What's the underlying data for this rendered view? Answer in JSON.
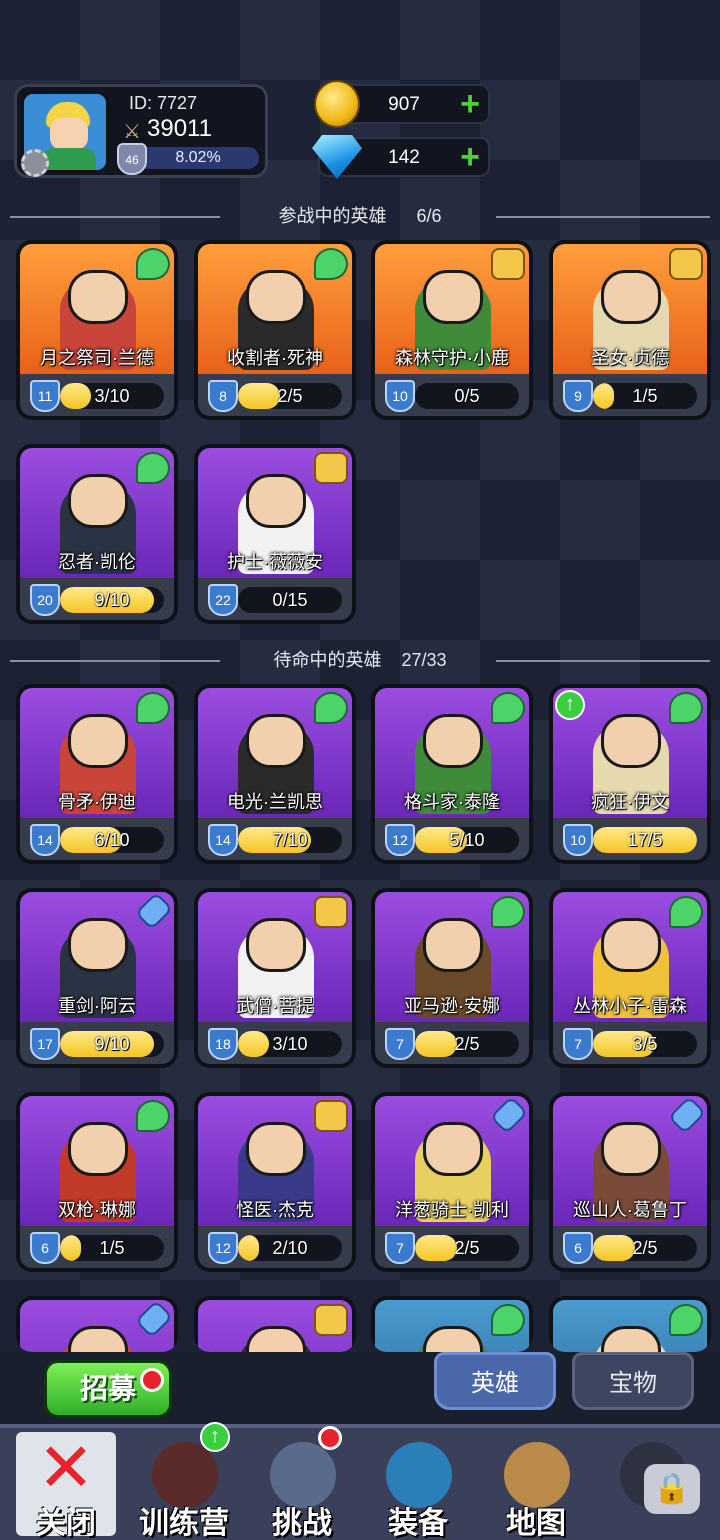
{
  "player": {
    "id_label": "ID: 7727",
    "power": "39011",
    "level": "46",
    "exp_percent": "8.02%"
  },
  "resources": {
    "gold": "907",
    "gems": "142",
    "plus": "+"
  },
  "sections": {
    "active_title": "参战中的英雄      6/6",
    "standby_title": "待命中的英雄    27/33"
  },
  "active_heroes": [
    {
      "name": "月之祭司·兰德",
      "level": "11",
      "progress": "3/10",
      "fill": 0.3,
      "color": "orange",
      "badge": "wing-icon"
    },
    {
      "name": "收割者·死神",
      "level": "8",
      "progress": "2/5",
      "fill": 0.4,
      "color": "orange",
      "badge": "wing-icon"
    },
    {
      "name": "森林守护·小鹿",
      "level": "10",
      "progress": "0/5",
      "fill": 0.0,
      "color": "orange",
      "badge": "book-icon"
    },
    {
      "name": "圣女·贞德",
      "level": "9",
      "progress": "1/5",
      "fill": 0.2,
      "color": "orange",
      "badge": "book-icon"
    },
    {
      "name": "忍者·凯伦",
      "level": "20",
      "progress": "9/10",
      "fill": 0.9,
      "color": "purple",
      "badge": "wing-icon"
    },
    {
      "name": "护士·薇薇安",
      "level": "22",
      "progress": "0/15",
      "fill": 0.0,
      "color": "purple",
      "badge": "book-icon"
    }
  ],
  "standby_heroes": [
    {
      "name": "骨矛·伊迪",
      "level": "14",
      "progress": "6/10",
      "fill": 0.6,
      "color": "purple",
      "badge": "wing-icon"
    },
    {
      "name": "电光·兰凯思",
      "level": "14",
      "progress": "7/10",
      "fill": 0.7,
      "color": "purple",
      "badge": "wing-icon"
    },
    {
      "name": "格斗家·泰隆",
      "level": "12",
      "progress": "5/10",
      "fill": 0.5,
      "color": "purple",
      "badge": "wing-icon"
    },
    {
      "name": "疯狂·伊文",
      "level": "10",
      "progress": "17/5",
      "fill": 1.0,
      "color": "purple",
      "badge": "wing-icon",
      "upgrade": true
    },
    {
      "name": "重剑·阿云",
      "level": "17",
      "progress": "9/10",
      "fill": 0.9,
      "color": "purple",
      "badge": "sword-icon"
    },
    {
      "name": "武僧·菩提",
      "level": "18",
      "progress": "3/10",
      "fill": 0.3,
      "color": "purple",
      "badge": "book-icon"
    },
    {
      "name": "亚马逊·安娜",
      "level": "7",
      "progress": "2/5",
      "fill": 0.4,
      "color": "purple",
      "badge": "wing-icon"
    },
    {
      "name": "丛林小子·雷森",
      "level": "7",
      "progress": "3/5",
      "fill": 0.6,
      "color": "purple",
      "badge": "wing-icon"
    },
    {
      "name": "双枪·琳娜",
      "level": "6",
      "progress": "1/5",
      "fill": 0.2,
      "color": "purple",
      "badge": "wing-icon"
    },
    {
      "name": "怪医·杰克",
      "level": "12",
      "progress": "2/10",
      "fill": 0.2,
      "color": "purple",
      "badge": "book-icon"
    },
    {
      "name": "洋葱骑士·凯利",
      "level": "7",
      "progress": "2/5",
      "fill": 0.4,
      "color": "purple",
      "badge": "sword-icon"
    },
    {
      "name": "巡山人·葛鲁丁",
      "level": "6",
      "progress": "2/5",
      "fill": 0.4,
      "color": "purple",
      "badge": "sword-icon"
    },
    {
      "name": "",
      "level": "",
      "progress": "",
      "fill": 0,
      "color": "purple",
      "badge": "sword-icon"
    },
    {
      "name": "",
      "level": "",
      "progress": "",
      "fill": 0,
      "color": "purple",
      "badge": "book-icon"
    },
    {
      "name": "",
      "level": "",
      "progress": "",
      "fill": 0,
      "color": "blue",
      "badge": "wing-icon"
    },
    {
      "name": "",
      "level": "",
      "progress": "",
      "fill": 0,
      "color": "blue",
      "badge": "wing-icon"
    }
  ],
  "actions": {
    "recruit_label": "招募"
  },
  "tabs": {
    "heroes": "英雄",
    "treasure": "宝物"
  },
  "nav": {
    "close": "关闭",
    "training": "训练营",
    "challenge": "挑战",
    "equipment": "装备",
    "map": "地图"
  }
}
